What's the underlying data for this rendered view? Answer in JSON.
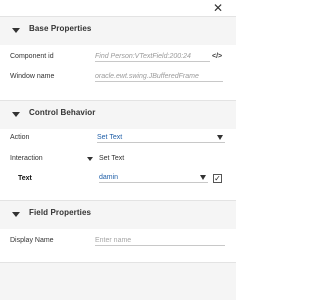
{
  "header": {
    "close_glyph": "✕"
  },
  "base": {
    "title": "Base Properties",
    "component_id_label": "Component id",
    "component_id_value": "Find Person:VTextField:200:24",
    "xpath_icon": "</>",
    "window_name_label": "Window name",
    "window_name_value": "oracle.ewt.swing.JBufferedFrame"
  },
  "control": {
    "title": "Control Behavior",
    "action_label": "Action",
    "action_value": "Set Text",
    "interaction_label": "Interaction",
    "interaction_value": "Set Text",
    "text_label": "Text",
    "text_value": "damin",
    "checkbox_glyph": "✓"
  },
  "field": {
    "title": "Field Properties",
    "display_name_label": "Display Name",
    "display_name_placeholder": "Enter name"
  },
  "colors": {
    "value_blue": "#1f5fa8",
    "header_bg": "#f5f5f5"
  }
}
